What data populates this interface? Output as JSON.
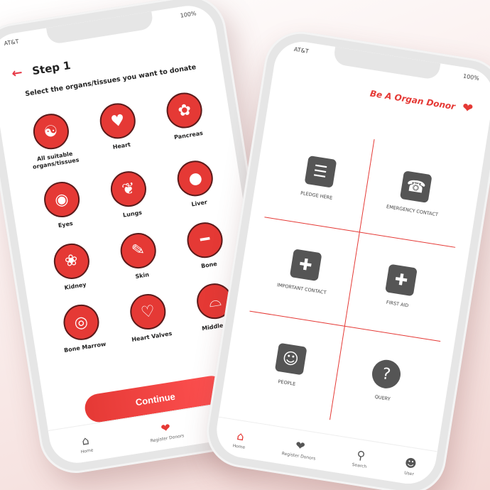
{
  "left_phone": {
    "status": {
      "carrier": "AT&T",
      "battery": "100%"
    },
    "header": {
      "back_icon": "arrow-left-icon",
      "title": "Step 1"
    },
    "instruction": "Select the organs/tissues you want to donate",
    "organs": [
      {
        "label": "All suitable organs/tissues",
        "icon": "body-icon"
      },
      {
        "label": "Heart",
        "icon": "heart-icon"
      },
      {
        "label": "Pancreas",
        "icon": "pancreas-icon"
      },
      {
        "label": "Eyes",
        "icon": "eye-icon"
      },
      {
        "label": "Lungs",
        "icon": "lungs-icon"
      },
      {
        "label": "Liver",
        "icon": "liver-icon"
      },
      {
        "label": "Kidney",
        "icon": "kidney-icon"
      },
      {
        "label": "Skin",
        "icon": "skin-icon"
      },
      {
        "label": "Bone",
        "icon": "bone-icon"
      },
      {
        "label": "Bone Marrow",
        "icon": "bone-marrow-icon"
      },
      {
        "label": "Heart Valves",
        "icon": "heart-valve-icon"
      },
      {
        "label": "Middle Ear",
        "icon": "ear-icon"
      }
    ],
    "continue_label": "Continue",
    "tabbar": [
      {
        "label": "Home",
        "icon": "home-icon"
      },
      {
        "label": "Register Donors",
        "icon": "hands-icon"
      },
      {
        "label": "",
        "icon": "search-icon"
      }
    ]
  },
  "right_phone": {
    "status": {
      "carrier": "AT&T",
      "battery": "100%"
    },
    "brand_title": "Be A Organ Donor",
    "brand_icon": "hand-heart-icon",
    "menu": [
      {
        "label": "PLEDGE HERE",
        "icon": "clipboard-icon"
      },
      {
        "label": "EMERGENCY CONTACT",
        "icon": "phone-icon"
      },
      {
        "label": "IMPORTANT CONTACT",
        "icon": "document-plus-icon"
      },
      {
        "label": "FIRST AID",
        "icon": "first-aid-icon"
      },
      {
        "label": "PEOPLE",
        "icon": "people-icon"
      },
      {
        "label": "QUERY",
        "icon": "question-icon"
      }
    ],
    "tabbar": [
      {
        "label": "Home",
        "icon": "home-icon"
      },
      {
        "label": "Register Donors",
        "icon": "hands-icon"
      },
      {
        "label": "Search",
        "icon": "search-icon"
      },
      {
        "label": "User",
        "icon": "user-icon"
      }
    ]
  }
}
